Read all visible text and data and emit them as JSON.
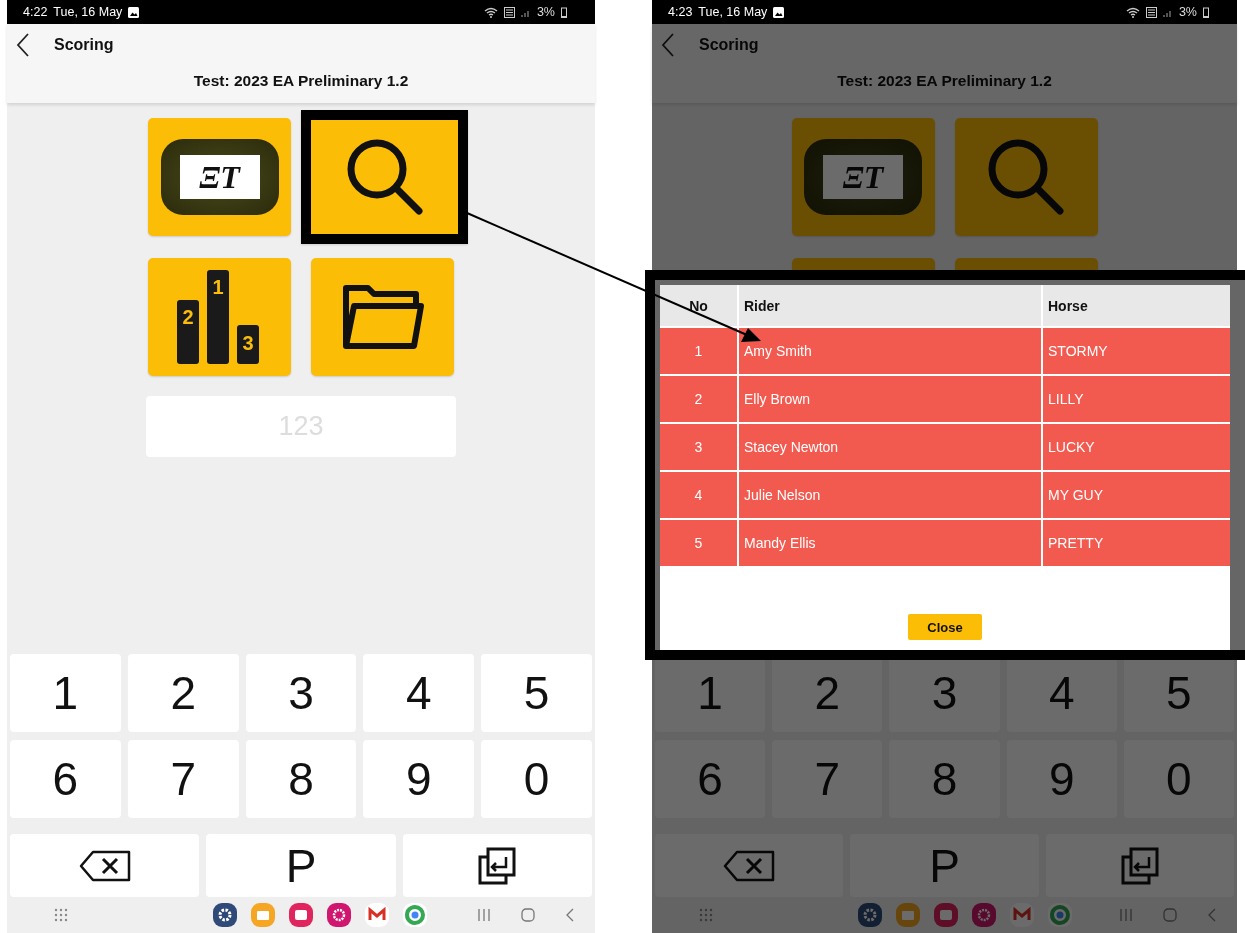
{
  "screens": [
    {
      "status_bar": {
        "time": "4:22",
        "date": "Tue, 16 May",
        "battery": "3%"
      },
      "header": {
        "title": "Scoring",
        "subtitle": "Test: 2023 EA Preliminary 1.2"
      },
      "dimmed": false,
      "tiles": [
        {
          "kind": "display",
          "text": "ΞT",
          "highlighted": false
        },
        {
          "kind": "search",
          "highlighted": true
        },
        {
          "kind": "podium",
          "numbers": [
            "1",
            "2",
            "3"
          ],
          "highlighted": false
        },
        {
          "kind": "folder",
          "highlighted": false
        }
      ],
      "input": {
        "placeholder": "123"
      },
      "keys": [
        {
          "kind": "digit",
          "label": "1"
        },
        {
          "kind": "digit",
          "label": "2"
        },
        {
          "kind": "digit",
          "label": "3"
        },
        {
          "kind": "digit",
          "label": "4"
        },
        {
          "kind": "digit",
          "label": "5"
        },
        {
          "kind": "digit",
          "label": "6"
        },
        {
          "kind": "digit",
          "label": "7"
        },
        {
          "kind": "digit",
          "label": "8"
        },
        {
          "kind": "digit",
          "label": "9"
        },
        {
          "kind": "digit",
          "label": "0"
        },
        {
          "kind": "backspace"
        },
        {
          "kind": "letter",
          "label": "P"
        },
        {
          "kind": "enter"
        }
      ]
    },
    {
      "status_bar": {
        "time": "4:23",
        "date": "Tue, 16 May",
        "battery": "3%"
      },
      "header": {
        "title": "Scoring",
        "subtitle": "Test: 2023 EA Preliminary 1.2"
      },
      "dimmed": true,
      "tiles": [
        {
          "kind": "display",
          "text": "ΞT",
          "highlighted": false
        },
        {
          "kind": "search",
          "highlighted": false
        },
        {
          "kind": "blank",
          "highlighted": false
        },
        {
          "kind": "blank",
          "highlighted": false
        }
      ],
      "keys": [
        {
          "kind": "digit",
          "label": "1"
        },
        {
          "kind": "digit",
          "label": "2"
        },
        {
          "kind": "digit",
          "label": "3"
        },
        {
          "kind": "digit",
          "label": "4"
        },
        {
          "kind": "digit",
          "label": "5"
        },
        {
          "kind": "digit",
          "label": "6"
        },
        {
          "kind": "digit",
          "label": "7"
        },
        {
          "kind": "digit",
          "label": "8"
        },
        {
          "kind": "digit",
          "label": "9"
        },
        {
          "kind": "digit",
          "label": "0"
        },
        {
          "kind": "backspace"
        },
        {
          "kind": "letter",
          "label": "P"
        },
        {
          "kind": "enter"
        }
      ],
      "dialog": {
        "columns": [
          "No",
          "Rider",
          "Horse"
        ],
        "rows": [
          [
            "1",
            "Amy Smith",
            "STORMY"
          ],
          [
            "2",
            "Elly Brown",
            "LILLY"
          ],
          [
            "3",
            "Stacey Newton",
            "LUCKY"
          ],
          [
            "4",
            "Julie Nelson",
            "MY GUY"
          ],
          [
            "5",
            "Mandy Ellis",
            "PRETTY"
          ]
        ],
        "close_button": "Close"
      }
    }
  ]
}
